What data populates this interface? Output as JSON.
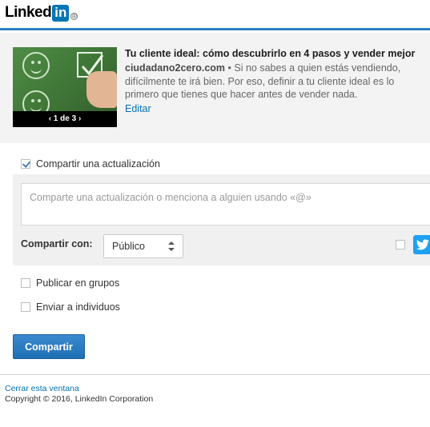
{
  "header": {
    "logo_text": "Linked",
    "logo_in": "in",
    "logo_reg": "®"
  },
  "preview": {
    "image_caption": "‹ 1 de 3 ›",
    "title": "Tu cliente ideal: cómo descubrirlo en 4 pasos y vender mejor",
    "domain": "ciudadano2cero.com",
    "separator": " • ",
    "description": "Si no sabes a quien estás vendiendo, difícilmente te irá bien. Por eso, definir a tu cliente ideal es lo primero que tienes que hacer antes de vender nada.",
    "edit_label": "Editar"
  },
  "share_update": {
    "label": "Compartir una actualización",
    "checked": true,
    "placeholder": "Comparte una actualización o menciona a alguien usando «@»",
    "share_with_label": "Compartir con:",
    "share_with_value": "Público"
  },
  "options": {
    "groups_label": "Publicar en grupos",
    "individuals_label": "Enviar a individuos"
  },
  "submit_label": "Compartir",
  "footer": {
    "close_label": "Cerrar esta ventana",
    "copyright": "Copyright © 2016, LinkedIn Corporation"
  },
  "colors": {
    "brand": "#0077b5",
    "link": "#0073b1",
    "button": "#1f6fb5",
    "twitter": "#1da1f2"
  }
}
